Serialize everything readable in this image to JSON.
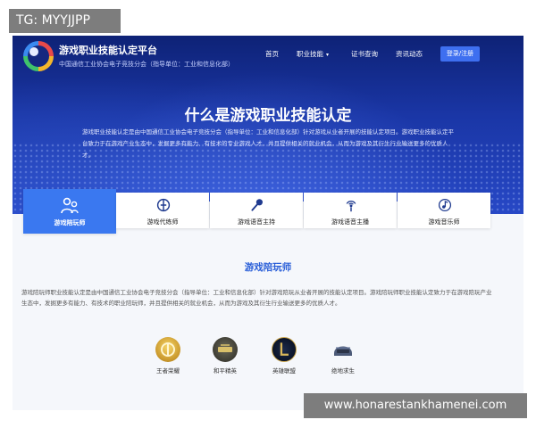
{
  "overlay": {
    "tg_label": "TG: MYYJJPP",
    "watermark": "www.honarestankhamenei.com"
  },
  "header": {
    "brand_title": "游戏职业技能认定平台",
    "brand_subtitle": "中国通信工业协会电子竞技分会（指导单位：工业和信息化部）",
    "nav": [
      {
        "label": "首页"
      },
      {
        "label": "职业技能",
        "has_dropdown": true
      },
      {
        "label": "证书查询"
      },
      {
        "label": "资讯动态"
      }
    ],
    "login_label": "登录/注册"
  },
  "hero": {
    "title": "什么是游戏职业技能认定",
    "description": "游戏职业技能认定是由中国通信工业协会电子竞技分会（指导单位：工业和信息化部）针对游戏从业者开展的技能认定项目。游戏职业技能认定平台致力于在游戏产业生态中，发掘更多有能力、有技术的专业游戏人才，并且提供相关的就业机会，从而为游戏及其衍生行业输送更多的优质人才。"
  },
  "tabs": [
    {
      "label": "游戏陪玩师",
      "icon": "people-icon",
      "active": true
    },
    {
      "label": "游戏代练师",
      "icon": "controller-icon",
      "active": false
    },
    {
      "label": "游戏语音主持",
      "icon": "microphone-icon",
      "active": false
    },
    {
      "label": "游戏语音主播",
      "icon": "broadcast-icon",
      "active": false
    },
    {
      "label": "游戏音乐师",
      "icon": "music-note-icon",
      "active": false
    }
  ],
  "section": {
    "title": "游戏陪玩师",
    "description": "游戏陪玩师职业技能认定是由中国通信工业协会电子竞技分会（指导单位：工业和信息化部）针对游戏陪玩从业者开展的技能认定项目。游戏陪玩师职业技能认定致力于在游戏陪玩产业生态中，发掘更多有能力、有技术的职业陪玩师，并且提供相关的就业机会，从而为游戏及其衍生行业输送更多的优质人才。"
  },
  "games": [
    {
      "label": "王者荣耀",
      "icon": "honor-of-kings-icon"
    },
    {
      "label": "和平精英",
      "icon": "peace-elite-icon"
    },
    {
      "label": "英雄联盟",
      "icon": "league-of-legends-icon"
    },
    {
      "label": "绝地求生",
      "icon": "pubg-helmet-icon"
    }
  ]
}
